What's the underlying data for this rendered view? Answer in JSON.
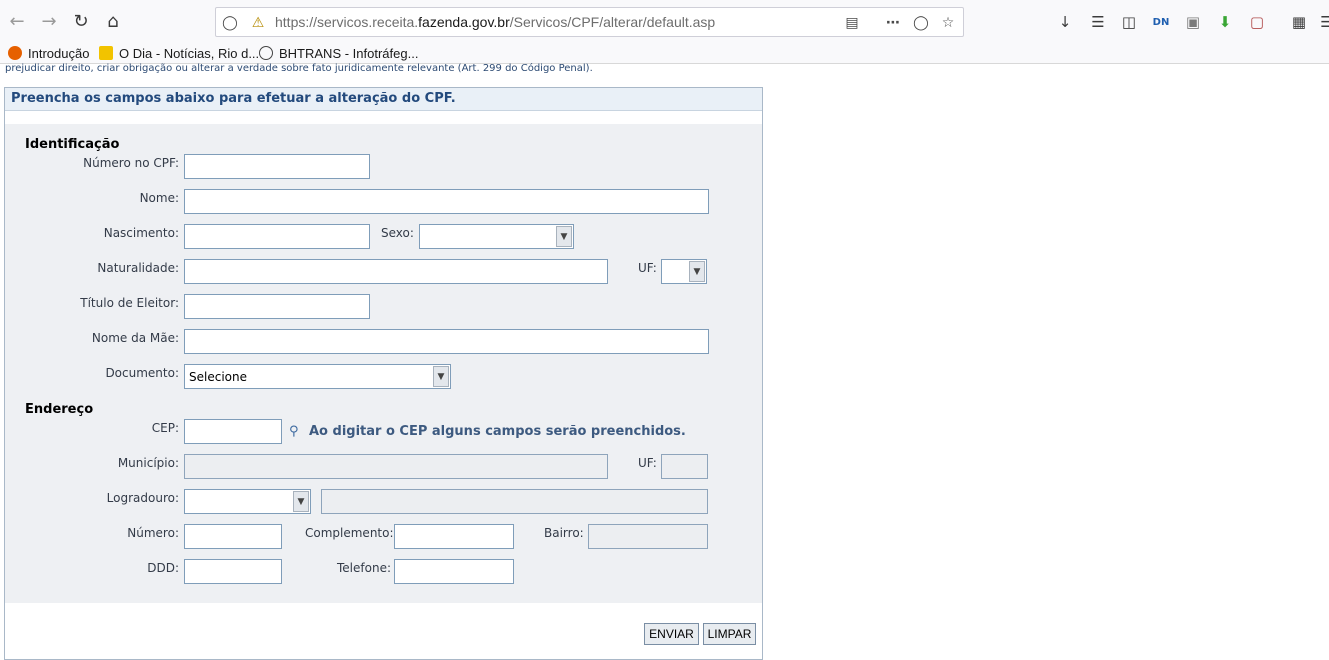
{
  "browser": {
    "url_prefix": "https://servicos.receita.",
    "url_domain": "fazenda.gov.br",
    "url_suffix": "/Servicos/CPF/alterar/default.asp",
    "bookmarks": [
      "Introdução",
      "O Dia - Notícias, Rio d...",
      "BHTRANS - Infotráfeg..."
    ]
  },
  "page": {
    "warning_text": "prejudicar direito, criar obrigação ou alterar a verdade sobre fato juridicamente relevante (Art. 299 do Código Penal).",
    "panel_title": "Preencha os campos abaixo para efetuar a alteração do CPF."
  },
  "identificacao": {
    "heading": "Identificação",
    "cpf_label": "Número no CPF:",
    "nome_label": "Nome:",
    "nascimento_label": "Nascimento:",
    "sexo_label": "Sexo:",
    "sexo_value": "",
    "naturalidade_label": "Naturalidade:",
    "uf_label": "UF:",
    "uf_value": "",
    "titulo_label": "Título de Eleitor:",
    "mae_label": "Nome da Mãe:",
    "documento_label": "Documento:",
    "documento_value": "Selecione"
  },
  "endereco": {
    "heading": "Endereço",
    "cep_label": "CEP:",
    "cep_hint": "Ao digitar o CEP alguns campos serão preenchidos.",
    "municipio_label": "Município:",
    "uf_label": "UF:",
    "logradouro_label": "Logradouro:",
    "logradouro_type_value": "",
    "numero_label": "Número:",
    "complemento_label": "Complemento:",
    "bairro_label": "Bairro:",
    "ddd_label": "DDD:",
    "telefone_label": "Telefone:"
  },
  "actions": {
    "submit_label": "ENVIAR",
    "reset_label": "LIMPAR"
  },
  "colors": {
    "accent": "#234a7d",
    "form_background": "#eef0f3",
    "header_background": "#e9f0f7"
  }
}
